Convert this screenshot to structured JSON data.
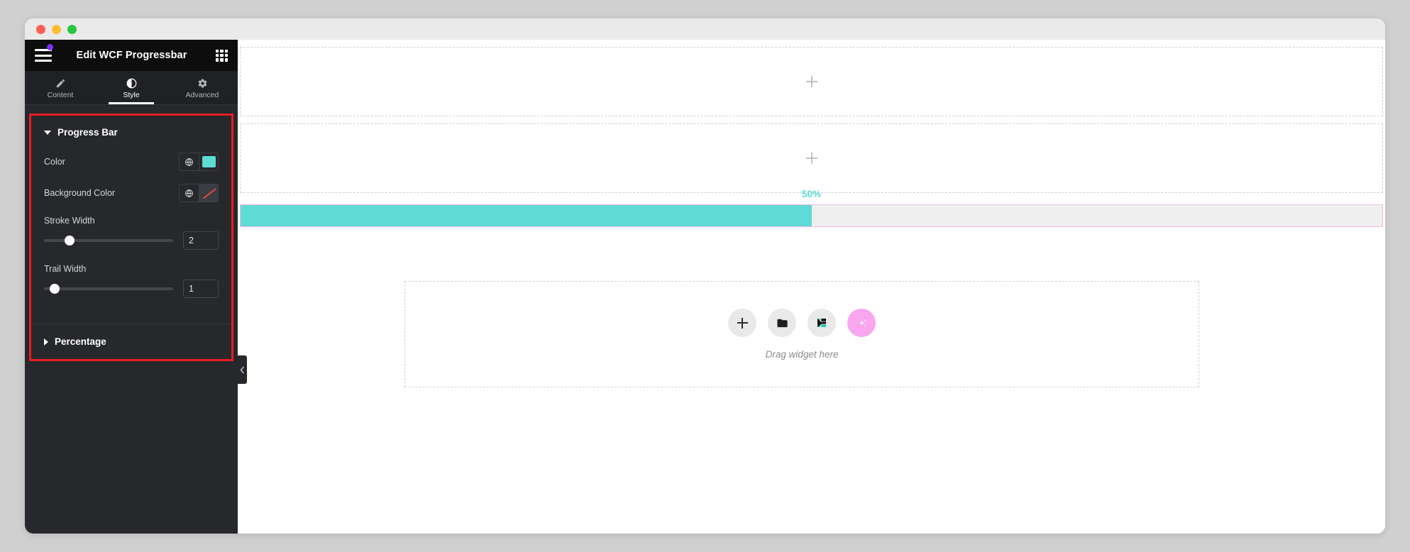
{
  "window": {
    "traffic_lights": [
      "close",
      "minimize",
      "maximize"
    ]
  },
  "panel": {
    "header": {
      "title": "Edit WCF Progressbar",
      "menu_icon": "hamburger-icon",
      "notification_dot_color": "#7b2ff7",
      "widgets_icon": "grid-icon"
    },
    "tabs": [
      {
        "label": "Content",
        "icon": "pencil-icon",
        "active": false
      },
      {
        "label": "Style",
        "icon": "contrast-icon",
        "active": true
      },
      {
        "label": "Advanced",
        "icon": "gear-icon",
        "active": false
      }
    ],
    "highlight_border_color": "#ec1c24",
    "sections": [
      {
        "title": "Progress Bar",
        "expanded": true,
        "controls": [
          {
            "type": "color",
            "label": "Color",
            "globe_icon": "globe-icon",
            "swatch_value": "#5fdbd5",
            "swatch_kind": "solid"
          },
          {
            "type": "color",
            "label": "Background Color",
            "globe_icon": "globe-icon",
            "swatch_value": "transparent",
            "swatch_kind": "none"
          },
          {
            "type": "slider",
            "label": "Stroke Width",
            "value": "2",
            "knob_percent": 20
          },
          {
            "type": "slider",
            "label": "Trail Width",
            "value": "1",
            "knob_percent": 8
          }
        ]
      },
      {
        "title": "Percentage",
        "expanded": false,
        "controls": []
      }
    ],
    "collapse_handle_icon": "chevron-left-icon"
  },
  "canvas": {
    "empty_containers": [
      {
        "add_icon": "plus-icon"
      },
      {
        "add_icon": "plus-icon"
      }
    ],
    "progressbar_widget": {
      "percent_label": "50%",
      "percent_value": 50,
      "fill_color": "#5fdbd5",
      "trail_color": "#efefef",
      "selection_border_color": "#f3b9e8"
    },
    "dropzone": {
      "hint": "Drag widget here",
      "buttons": [
        {
          "name": "add-element-button",
          "icon": "plus-icon"
        },
        {
          "name": "add-template-button",
          "icon": "folder-icon"
        },
        {
          "name": "elementor-logo-button",
          "icon": "elementor-logo-icon"
        },
        {
          "name": "ai-button",
          "icon": "sparkle-icon"
        }
      ]
    }
  }
}
